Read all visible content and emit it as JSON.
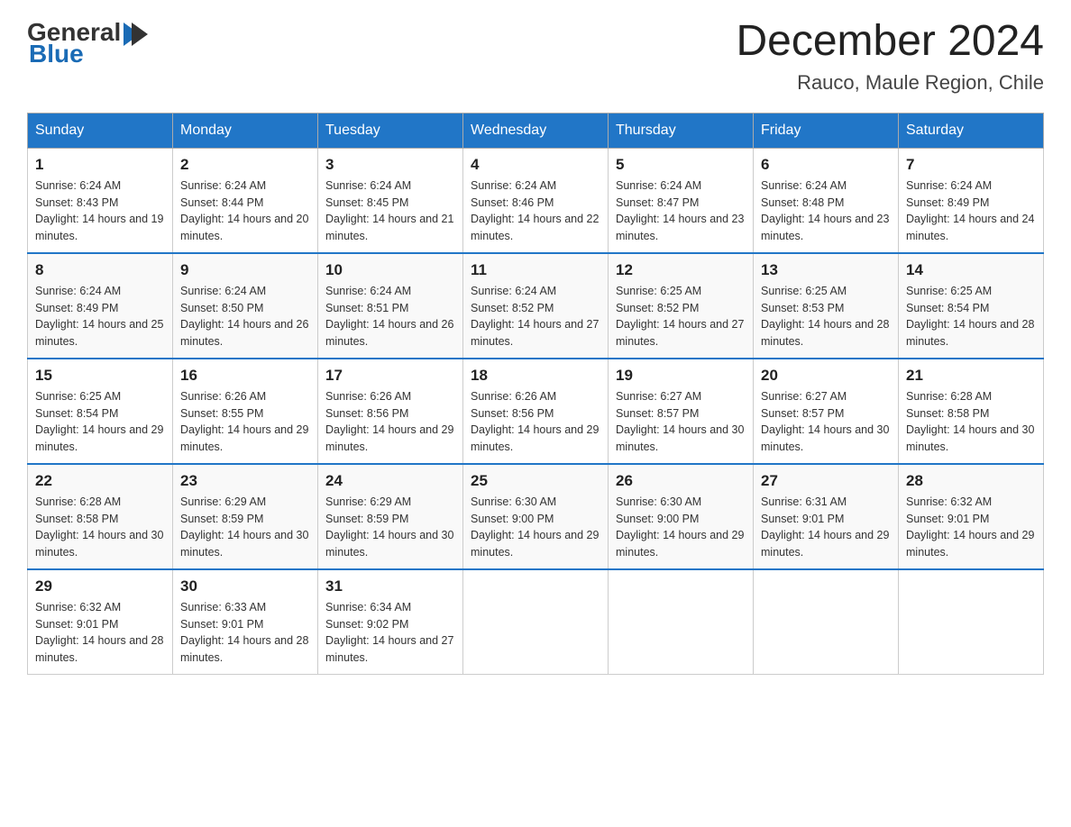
{
  "header": {
    "logo_general": "General",
    "logo_blue": "Blue",
    "main_title": "December 2024",
    "subtitle": "Rauco, Maule Region, Chile"
  },
  "calendar": {
    "columns": [
      "Sunday",
      "Monday",
      "Tuesday",
      "Wednesday",
      "Thursday",
      "Friday",
      "Saturday"
    ],
    "weeks": [
      [
        {
          "day": "1",
          "sunrise": "6:24 AM",
          "sunset": "8:43 PM",
          "daylight": "14 hours and 19 minutes."
        },
        {
          "day": "2",
          "sunrise": "6:24 AM",
          "sunset": "8:44 PM",
          "daylight": "14 hours and 20 minutes."
        },
        {
          "day": "3",
          "sunrise": "6:24 AM",
          "sunset": "8:45 PM",
          "daylight": "14 hours and 21 minutes."
        },
        {
          "day": "4",
          "sunrise": "6:24 AM",
          "sunset": "8:46 PM",
          "daylight": "14 hours and 22 minutes."
        },
        {
          "day": "5",
          "sunrise": "6:24 AM",
          "sunset": "8:47 PM",
          "daylight": "14 hours and 23 minutes."
        },
        {
          "day": "6",
          "sunrise": "6:24 AM",
          "sunset": "8:48 PM",
          "daylight": "14 hours and 23 minutes."
        },
        {
          "day": "7",
          "sunrise": "6:24 AM",
          "sunset": "8:49 PM",
          "daylight": "14 hours and 24 minutes."
        }
      ],
      [
        {
          "day": "8",
          "sunrise": "6:24 AM",
          "sunset": "8:49 PM",
          "daylight": "14 hours and 25 minutes."
        },
        {
          "day": "9",
          "sunrise": "6:24 AM",
          "sunset": "8:50 PM",
          "daylight": "14 hours and 26 minutes."
        },
        {
          "day": "10",
          "sunrise": "6:24 AM",
          "sunset": "8:51 PM",
          "daylight": "14 hours and 26 minutes."
        },
        {
          "day": "11",
          "sunrise": "6:24 AM",
          "sunset": "8:52 PM",
          "daylight": "14 hours and 27 minutes."
        },
        {
          "day": "12",
          "sunrise": "6:25 AM",
          "sunset": "8:52 PM",
          "daylight": "14 hours and 27 minutes."
        },
        {
          "day": "13",
          "sunrise": "6:25 AM",
          "sunset": "8:53 PM",
          "daylight": "14 hours and 28 minutes."
        },
        {
          "day": "14",
          "sunrise": "6:25 AM",
          "sunset": "8:54 PM",
          "daylight": "14 hours and 28 minutes."
        }
      ],
      [
        {
          "day": "15",
          "sunrise": "6:25 AM",
          "sunset": "8:54 PM",
          "daylight": "14 hours and 29 minutes."
        },
        {
          "day": "16",
          "sunrise": "6:26 AM",
          "sunset": "8:55 PM",
          "daylight": "14 hours and 29 minutes."
        },
        {
          "day": "17",
          "sunrise": "6:26 AM",
          "sunset": "8:56 PM",
          "daylight": "14 hours and 29 minutes."
        },
        {
          "day": "18",
          "sunrise": "6:26 AM",
          "sunset": "8:56 PM",
          "daylight": "14 hours and 29 minutes."
        },
        {
          "day": "19",
          "sunrise": "6:27 AM",
          "sunset": "8:57 PM",
          "daylight": "14 hours and 30 minutes."
        },
        {
          "day": "20",
          "sunrise": "6:27 AM",
          "sunset": "8:57 PM",
          "daylight": "14 hours and 30 minutes."
        },
        {
          "day": "21",
          "sunrise": "6:28 AM",
          "sunset": "8:58 PM",
          "daylight": "14 hours and 30 minutes."
        }
      ],
      [
        {
          "day": "22",
          "sunrise": "6:28 AM",
          "sunset": "8:58 PM",
          "daylight": "14 hours and 30 minutes."
        },
        {
          "day": "23",
          "sunrise": "6:29 AM",
          "sunset": "8:59 PM",
          "daylight": "14 hours and 30 minutes."
        },
        {
          "day": "24",
          "sunrise": "6:29 AM",
          "sunset": "8:59 PM",
          "daylight": "14 hours and 30 minutes."
        },
        {
          "day": "25",
          "sunrise": "6:30 AM",
          "sunset": "9:00 PM",
          "daylight": "14 hours and 29 minutes."
        },
        {
          "day": "26",
          "sunrise": "6:30 AM",
          "sunset": "9:00 PM",
          "daylight": "14 hours and 29 minutes."
        },
        {
          "day": "27",
          "sunrise": "6:31 AM",
          "sunset": "9:01 PM",
          "daylight": "14 hours and 29 minutes."
        },
        {
          "day": "28",
          "sunrise": "6:32 AM",
          "sunset": "9:01 PM",
          "daylight": "14 hours and 29 minutes."
        }
      ],
      [
        {
          "day": "29",
          "sunrise": "6:32 AM",
          "sunset": "9:01 PM",
          "daylight": "14 hours and 28 minutes."
        },
        {
          "day": "30",
          "sunrise": "6:33 AM",
          "sunset": "9:01 PM",
          "daylight": "14 hours and 28 minutes."
        },
        {
          "day": "31",
          "sunrise": "6:34 AM",
          "sunset": "9:02 PM",
          "daylight": "14 hours and 27 minutes."
        },
        null,
        null,
        null,
        null
      ]
    ]
  }
}
